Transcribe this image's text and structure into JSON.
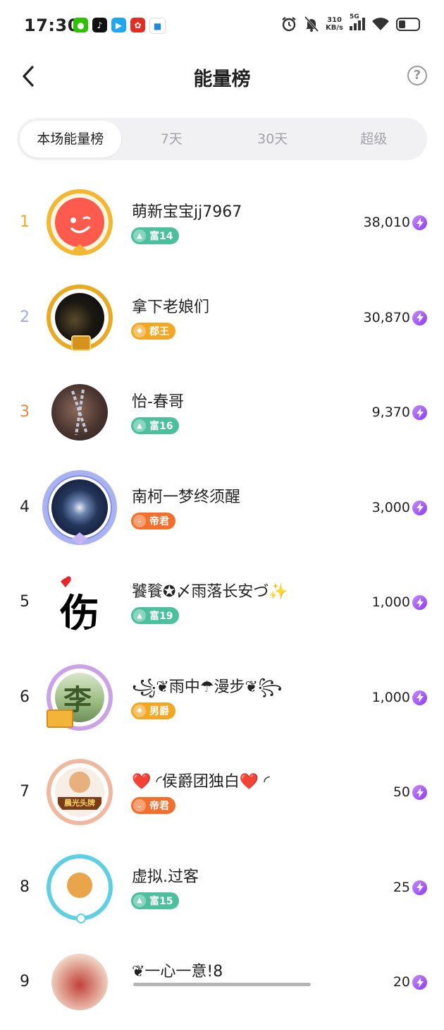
{
  "status_bar": {
    "time": "17:30",
    "net_speed_value": "310",
    "net_speed_unit": "KB/s",
    "network": "5G",
    "apps": [
      {
        "name": "wechat-icon",
        "color": "#2dc100"
      },
      {
        "name": "tiktok-icon",
        "color": "#111111"
      },
      {
        "name": "video-icon",
        "color": "#1fa8f0"
      },
      {
        "name": "shopping-icon",
        "color": "#e02e24"
      },
      {
        "name": "message-icon",
        "color": "#1e88e5"
      }
    ]
  },
  "header": {
    "title": "能量榜",
    "help_label": "?"
  },
  "tabs": [
    {
      "label": "本场能量榜",
      "active": true
    },
    {
      "label": "7天",
      "active": false
    },
    {
      "label": "30天",
      "active": false
    },
    {
      "label": "超级",
      "active": false
    }
  ],
  "rows": [
    {
      "rank": "1",
      "rank_color": "#f5a623",
      "name": "萌新宝宝jj7967",
      "badge": "富14",
      "badge_type": "fu",
      "score": "38,010"
    },
    {
      "rank": "2",
      "rank_color": "#9da9ee",
      "name": "拿下老娘们",
      "badge": "郡王",
      "badge_type": "gold",
      "score": "30,870"
    },
    {
      "rank": "3",
      "rank_color": "#e28a44",
      "name": "怡-春哥",
      "badge": "富16",
      "badge_type": "fu",
      "score": "9,370"
    },
    {
      "rank": "4",
      "rank_color": "#222222",
      "name": "南柯一梦终须醒",
      "badge": "帝君",
      "badge_type": "orange",
      "score": "3,000"
    },
    {
      "rank": "5",
      "rank_color": "#222222",
      "name": "饕餮✪〆雨落长安づ✨",
      "badge": "富19",
      "badge_type": "fu",
      "score": "1,000"
    },
    {
      "rank": "6",
      "rank_color": "#222222",
      "name": "꧁❦雨中☂漫步❦꧂",
      "badge": "男爵",
      "badge_type": "gold",
      "score": "1,000"
    },
    {
      "rank": "7",
      "rank_color": "#222222",
      "name": "❤️ ◜侯爵团独白❤️ ◜",
      "badge": "帝君",
      "badge_type": "orange",
      "score": "50"
    },
    {
      "rank": "8",
      "rank_color": "#222222",
      "name": "虚拟.过客",
      "badge": "富15",
      "badge_type": "fu",
      "score": "25"
    },
    {
      "rank": "9",
      "rank_color": "#222222",
      "name": "❦一心一意!8",
      "badge": "",
      "badge_type": "none",
      "score": "20"
    }
  ],
  "avatar_text": {
    "row5": "伤",
    "row6": "李",
    "row7": "晨光头牌"
  },
  "colors": {
    "fu_badge": "#4cbf9c",
    "gold_badge": "#f3a722",
    "orange_badge": "#f36f2b",
    "bolt": "#8b3bf2"
  }
}
